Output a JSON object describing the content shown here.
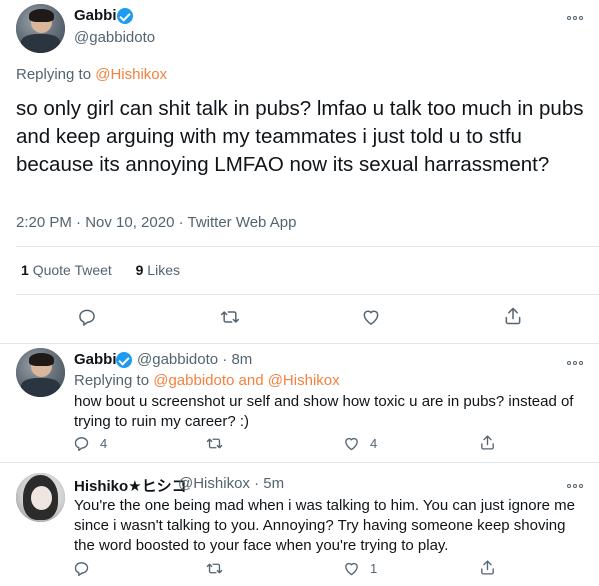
{
  "main_tweet": {
    "name": "Gabbi",
    "handle": "@gabbidoto",
    "replying_prefix": "Replying to ",
    "replying_to": "@Hishikox",
    "text": "so only girl can shit talk in pubs? lmfao u talk too much in pubs and keep arguing with my teammates i just told u to stfu because its annoying LMFAO now its sexual harrassment?",
    "meta": "2:20 PM · Nov 10, 2020 · Twitter Web App",
    "quote_count": "1",
    "quote_label": "Quote Tweet",
    "like_count": "9",
    "like_label": "Likes"
  },
  "reply_1": {
    "name": "Gabbi",
    "handle_time": "@gabbidoto · 8m",
    "replying_prefix": "Replying to ",
    "replying_to": "@gabbidoto and @Hishikox",
    "text": "how bout u screenshot ur self and show how toxic u are in pubs? instead of trying to ruin my career? :)",
    "reply_count": "4",
    "like_count": "4"
  },
  "reply_2": {
    "name": "Hishiko★ヒシコ",
    "handle_time": "@Hishikox · 5m",
    "text": "You're the one being mad when i was talking to him. You can just ignore me since i wasn't talking to you. Annoying? Try having someone keep shoving the word boosted to your face when you're trying to play.",
    "like_count": "1"
  },
  "icons": {
    "reply": "reply-icon",
    "retweet": "retweet-icon",
    "like": "like-icon",
    "share": "share-icon",
    "more": "more-icon",
    "verified": "verified-badge-icon"
  },
  "colors": {
    "link": "#f4813f",
    "verified": "#1d9bf0",
    "secondary_text": "#536471"
  }
}
